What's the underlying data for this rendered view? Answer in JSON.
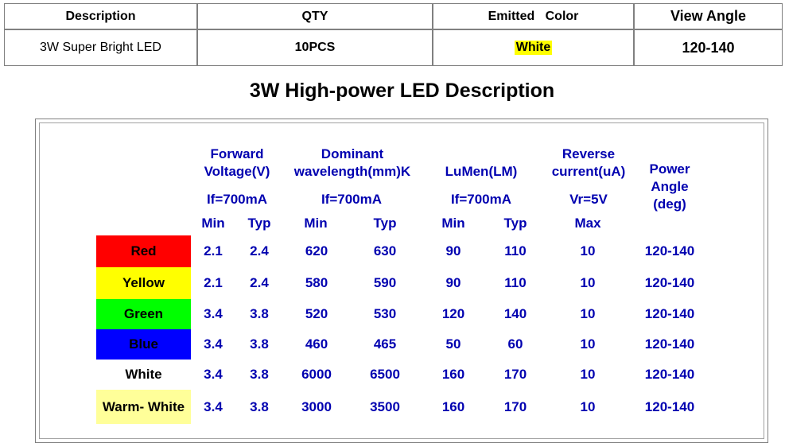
{
  "product_table": {
    "headers": [
      "Description",
      "QTY",
      "Emitted   Color",
      "View Angle"
    ],
    "row": [
      "3W Super Bright LED",
      "10PCS",
      "White",
      "120-140"
    ]
  },
  "title": "3W High-power LED Description",
  "spec": {
    "col_headers": {
      "forward_voltage": "Forward\nVoltage(V)",
      "dominant_wavelength": "Dominant\nwavelength(mm)K",
      "lumen": "LuMen(LM)",
      "reverse_current": "Reverse\ncurrent(uA)",
      "power_angle": "Power\nAngle\n(deg)"
    },
    "conditions": {
      "forward_voltage": "If=700mA",
      "dominant_wavelength": "If=700mA",
      "lumen": "If=700mA",
      "reverse_current": "Vr=5V"
    },
    "sub_headers": [
      "Min",
      "Typ",
      "Min",
      "Typ",
      "Min",
      "Typ",
      "Max"
    ],
    "rows": [
      {
        "color": "Red",
        "swatch": "#ff0000",
        "vf_min": "2.1",
        "vf_typ": "2.4",
        "wl_min": "620",
        "wl_typ": "630",
        "lm_min": "90",
        "lm_typ": "110",
        "ir_max": "10",
        "angle": "120-140"
      },
      {
        "color": "Yellow",
        "swatch": "#ffff00",
        "vf_min": "2.1",
        "vf_typ": "2.4",
        "wl_min": "580",
        "wl_typ": "590",
        "lm_min": "90",
        "lm_typ": "110",
        "ir_max": "10",
        "angle": "120-140"
      },
      {
        "color": "Green",
        "swatch": "#00ff00",
        "vf_min": "3.4",
        "vf_typ": "3.8",
        "wl_min": "520",
        "wl_typ": "530",
        "lm_min": "120",
        "lm_typ": "140",
        "ir_max": "10",
        "angle": "120-140"
      },
      {
        "color": "Blue",
        "swatch": "#0000ff",
        "vf_min": "3.4",
        "vf_typ": "3.8",
        "wl_min": "460",
        "wl_typ": "465",
        "lm_min": "50",
        "lm_typ": "60",
        "ir_max": "10",
        "angle": "120-140"
      },
      {
        "color": "White",
        "swatch": "#ffffff",
        "vf_min": "3.4",
        "vf_typ": "3.8",
        "wl_min": "6000",
        "wl_typ": "6500",
        "lm_min": "160",
        "lm_typ": "170",
        "ir_max": "10",
        "angle": "120-140"
      },
      {
        "color": "Warm- White",
        "swatch": "#ffff99",
        "vf_min": "3.4",
        "vf_typ": "3.8",
        "wl_min": "3000",
        "wl_typ": "3500",
        "lm_min": "160",
        "lm_typ": "170",
        "ir_max": "10",
        "angle": "120-140"
      }
    ]
  }
}
